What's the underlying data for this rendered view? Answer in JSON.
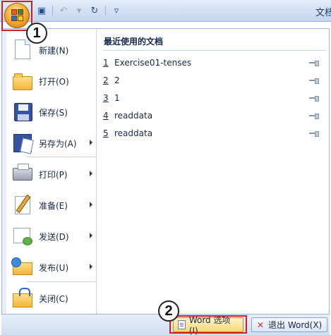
{
  "title_bar": {
    "window_title": "文档",
    "qat_icons": [
      "save-icon",
      "undo-icon",
      "redo-icon",
      "customize-qat-icon"
    ]
  },
  "callouts": {
    "one": "1",
    "two": "2"
  },
  "menu": {
    "items": [
      {
        "label": "新建(N)",
        "icon": "new-document-icon",
        "has_submenu": false
      },
      {
        "label": "打开(O)",
        "icon": "open-folder-icon",
        "has_submenu": false
      },
      {
        "label": "保存(S)",
        "icon": "save-disk-icon",
        "has_submenu": false
      },
      {
        "label": "另存为(A)",
        "icon": "save-as-icon",
        "has_submenu": true
      },
      {
        "label": "打印(P)",
        "icon": "printer-icon",
        "has_submenu": true
      },
      {
        "label": "准备(E)",
        "icon": "prepare-icon",
        "has_submenu": true
      },
      {
        "label": "发送(D)",
        "icon": "send-icon",
        "has_submenu": true
      },
      {
        "label": "发布(U)",
        "icon": "publish-icon",
        "has_submenu": true
      },
      {
        "label": "关闭(C)",
        "icon": "close-folder-icon",
        "has_submenu": false
      }
    ]
  },
  "recent": {
    "title": "最近使用的文档",
    "items": [
      {
        "num": "1",
        "name": "Exercise01-tenses"
      },
      {
        "num": "2",
        "name": "2"
      },
      {
        "num": "3",
        "name": "1"
      },
      {
        "num": "4",
        "name": "readdata"
      },
      {
        "num": "5",
        "name": "readdata"
      }
    ]
  },
  "bottom": {
    "options_label": "Word 选项(I)",
    "exit_label": "退出 Word(X)"
  },
  "colors": {
    "highlight_frame": "#d21d1d",
    "ribbon_blue": "#d3e1f4",
    "text": "#15284b"
  }
}
